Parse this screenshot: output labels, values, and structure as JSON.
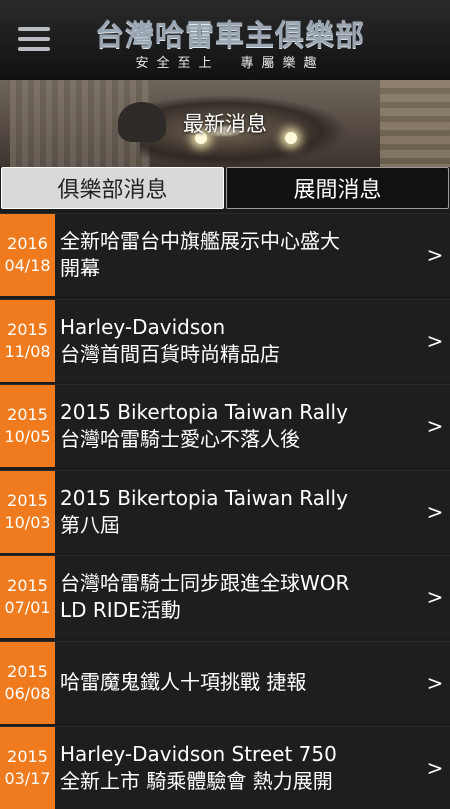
{
  "header": {
    "title": "台灣哈雷車主俱樂部",
    "subtitle": "安全至上　專屬樂趣"
  },
  "banner": {
    "title": "最新消息"
  },
  "tabs": [
    {
      "label": "俱樂部消息",
      "active": true
    },
    {
      "label": "展間消息",
      "active": false
    }
  ],
  "news": [
    {
      "year": "2016",
      "date": "04/18",
      "line1": "全新哈雷台中旗艦展示中心盛大",
      "line2": "開幕",
      "chevron": ">"
    },
    {
      "year": "2015",
      "date": "11/08",
      "line1": "Harley-Davidson",
      "line2": "台灣首間百貨時尚精品店",
      "chevron": ">"
    },
    {
      "year": "2015",
      "date": "10/05",
      "line1": "2015 Bikertopia Taiwan Rally",
      "line2": "台灣哈雷騎士愛心不落人後",
      "chevron": ">"
    },
    {
      "year": "2015",
      "date": "10/03",
      "line1": "2015 Bikertopia Taiwan Rally",
      "line2": "第八屆",
      "chevron": ">"
    },
    {
      "year": "2015",
      "date": "07/01",
      "line1": "台灣哈雷騎士同步跟進全球WOR",
      "line2": "LD RIDE活動",
      "chevron": ">"
    },
    {
      "year": "2015",
      "date": "06/08",
      "line1": "哈雷魔鬼鐵人十項挑戰 捷報",
      "line2": "",
      "chevron": ">"
    },
    {
      "year": "2015",
      "date": "03/17",
      "line1": "Harley-Davidson Street 750",
      "line2": "全新上市 騎乘體驗會 熱力展開",
      "chevron": ">"
    }
  ],
  "colors": {
    "date_accent": "#f07b1e",
    "background": "#1b1b1b"
  },
  "icons": {
    "menu": "hamburger-menu-icon",
    "row_arrow": "chevron-right-icon"
  }
}
